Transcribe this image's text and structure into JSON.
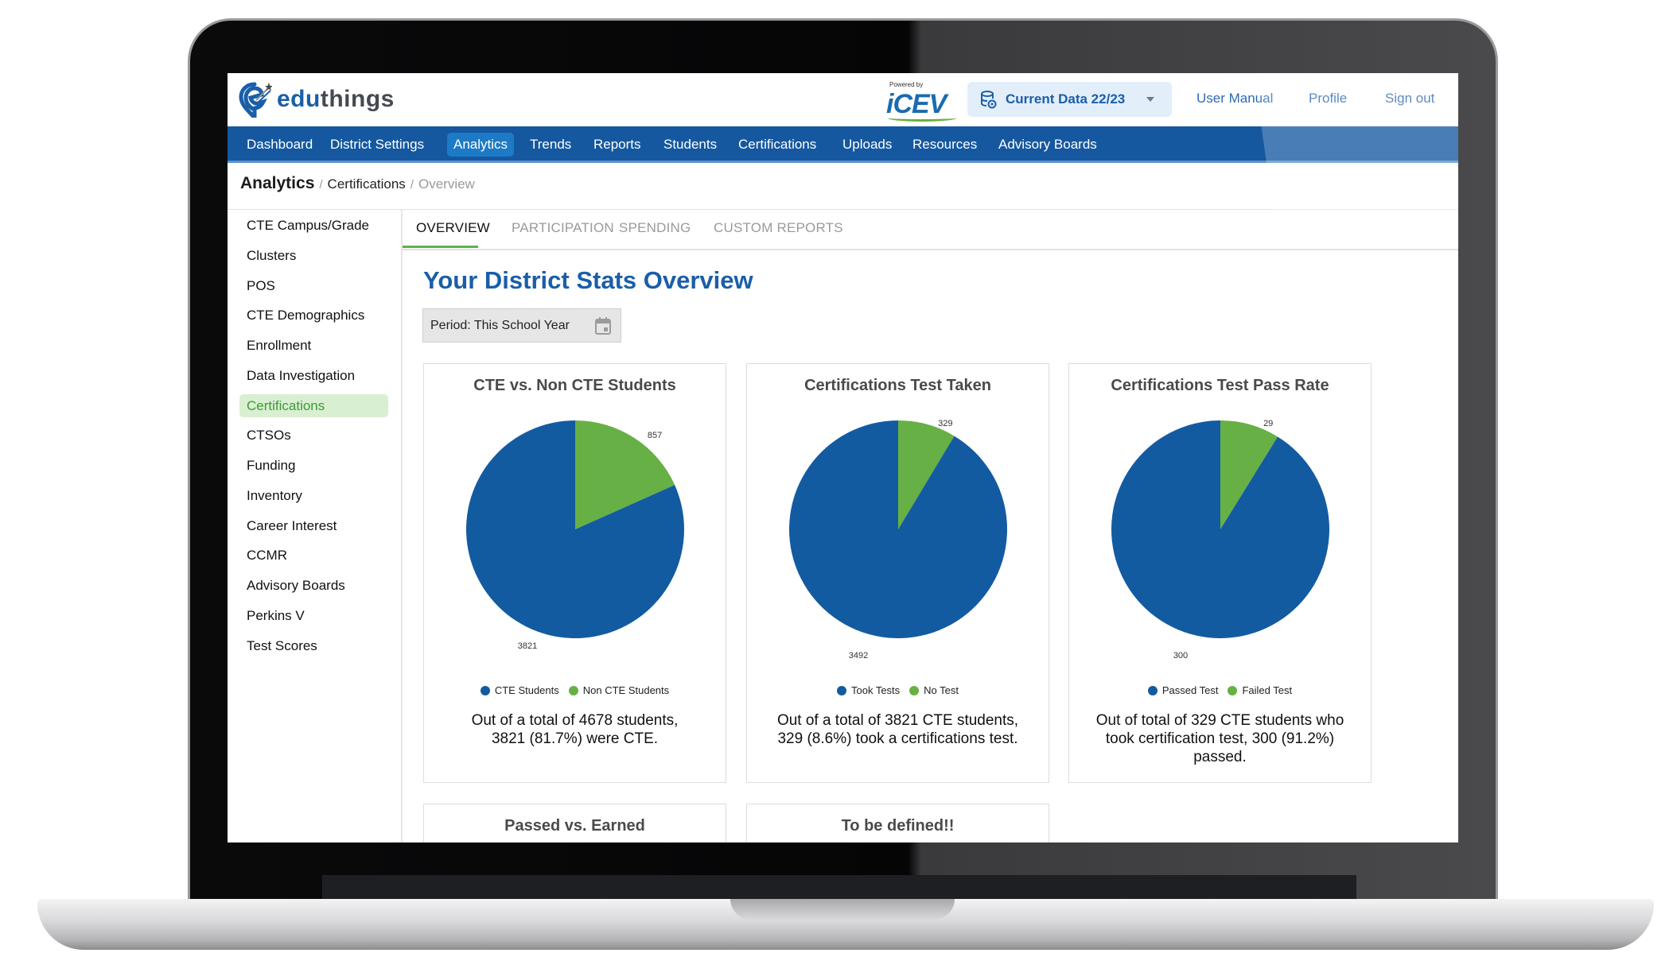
{
  "brand": {
    "name_part1": "edu",
    "name_part2": "things",
    "powered_by": "Powered by",
    "partner": "iCEV"
  },
  "header": {
    "data_selector": "Current Data 22/23",
    "links": [
      "User Manual",
      "Profile",
      "Sign out"
    ]
  },
  "nav": {
    "items": [
      "Dashboard",
      "District Settings",
      "Analytics",
      "Trends",
      "Reports",
      "Students",
      "Certifications",
      "Uploads",
      "Resources",
      "Advisory Boards"
    ],
    "active": "Analytics"
  },
  "breadcrumb": {
    "main": "Analytics",
    "sep": "/",
    "mid": "Certifications",
    "last": "Overview"
  },
  "sidebar": {
    "items": [
      "CTE Campus/Grade",
      "Clusters",
      "POS",
      "CTE Demographics",
      "Enrollment",
      "Data Investigation",
      "Certifications",
      "CTSOs",
      "Funding",
      "Inventory",
      "Career Interest",
      "CCMR",
      "Advisory Boards",
      "Perkins V",
      "Test Scores"
    ],
    "active": "Certifications"
  },
  "tabs": {
    "items": [
      "OVERVIEW",
      "PARTICIPATION",
      "SPENDING",
      "CUSTOM REPORTS"
    ],
    "active": "OVERVIEW"
  },
  "page": {
    "title": "Your District Stats Overview",
    "period_label": "Period: This School Year"
  },
  "colors": {
    "primary_blue": "#135ba1",
    "green": "#67b045",
    "accent_nav": "#1558a0"
  },
  "chart_data": [
    {
      "type": "pie",
      "title": "CTE vs. Non CTE Students",
      "categories": [
        "CTE Students",
        "Non CTE Students"
      ],
      "values": [
        3821,
        857
      ],
      "colors": [
        "#135ba1",
        "#67b045"
      ],
      "legend": "bottom",
      "summary_line1": "Out of a total of 4678 students,",
      "summary_line2": "3821 (81.7%) were CTE.",
      "summary_line3": ""
    },
    {
      "type": "pie",
      "title": "Certifications Test Taken",
      "categories": [
        "Took Tests",
        "No Test"
      ],
      "values": [
        3492,
        329
      ],
      "colors": [
        "#135ba1",
        "#67b045"
      ],
      "legend": "bottom",
      "summary_line1": "Out of a total of 3821 CTE students,",
      "summary_line2": "329 (8.6%) took a certifications test.",
      "summary_line3": ""
    },
    {
      "type": "pie",
      "title": "Certifications Test Pass Rate",
      "categories": [
        "Passed Test",
        "Failed Test"
      ],
      "values": [
        300,
        29
      ],
      "colors": [
        "#135ba1",
        "#67b045"
      ],
      "legend": "bottom",
      "summary_line1": "Out of total of 329 CTE students who",
      "summary_line2": "took certification test, 300 (91.2%)",
      "summary_line3": "passed."
    }
  ],
  "more_cards": [
    "Passed vs. Earned",
    "To be defined!!"
  ]
}
